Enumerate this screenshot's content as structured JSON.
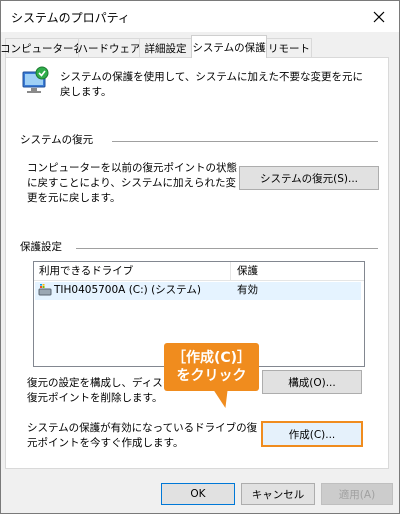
{
  "window": {
    "title": "システムのプロパティ"
  },
  "tabs": [
    {
      "label": "コンピューター名"
    },
    {
      "label": "ハードウェア"
    },
    {
      "label": "詳細設定"
    },
    {
      "label": "システムの保護"
    },
    {
      "label": "リモート"
    }
  ],
  "intro": {
    "text": "システムの保護を使用して、システムに加えた不要な変更を元に戻します。"
  },
  "restore": {
    "group_title": "システムの復元",
    "description": "コンピューターを以前の復元ポイントの状態に戻すことにより、システムに加えられた変更を元に戻します。",
    "button_label": "システムの復元(S)..."
  },
  "protection": {
    "group_title": "保護設定",
    "columns": [
      "利用できるドライブ",
      "保護"
    ],
    "rows": [
      {
        "drive": "TIH0405700A (C:) (システム)",
        "status": "有効"
      }
    ],
    "configure_text": "復元の設定を構成し、ディスク領域を管理して、復元ポイントを削除します。",
    "configure_button": "構成(O)...",
    "create_text": "システムの保護が有効になっているドライブの復元ポイントを今すぐ作成します。",
    "create_button": "作成(C)..."
  },
  "callout": {
    "line1": "［作成(C)］",
    "line2": "をクリック"
  },
  "footer": {
    "ok": "OK",
    "cancel": "キャンセル",
    "apply": "適用(A)"
  },
  "colors": {
    "accent": "#f08c1e"
  }
}
